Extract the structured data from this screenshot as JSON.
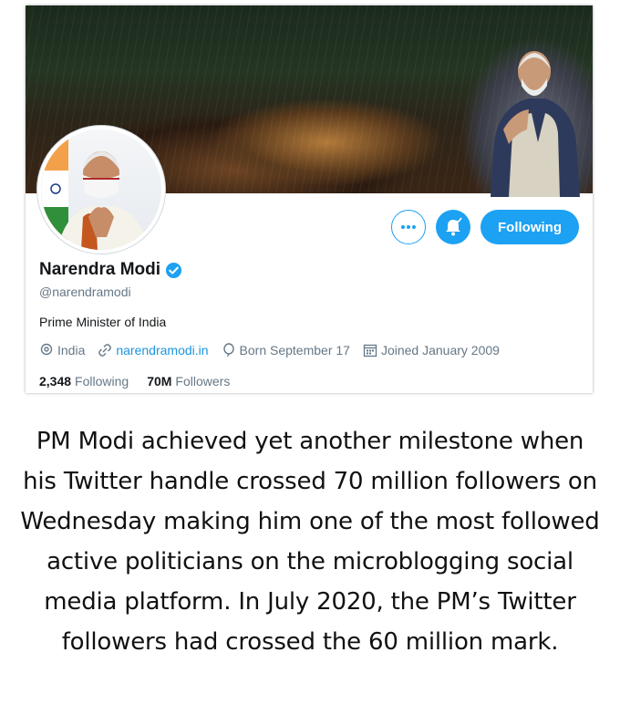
{
  "profile": {
    "name": "Narendra Modi",
    "handle": "@narendramodi",
    "bio": "Prime Minister of India",
    "location": "India",
    "website": "narendramodi.in",
    "born": "Born September 17",
    "joined": "Joined January 2009",
    "following_count": "2,348",
    "following_label": "Following",
    "followers_count": "70M",
    "followers_label": "Followers"
  },
  "actions": {
    "following_button_label": "Following",
    "more_icon": "more-icon",
    "bell_icon": "bell-icon"
  },
  "colors": {
    "accent": "#1da1f2",
    "link": "#1b95e0",
    "secondary_text": "#657786"
  },
  "caption": {
    "text": "PM Modi achieved yet another milestone when his Twitter handle crossed 70 million followers on Wednesday making him one of the most followed active politicians on the microblogging social media platform. In July 2020, the PM’s Twitter followers had crossed the 60 million mark."
  }
}
